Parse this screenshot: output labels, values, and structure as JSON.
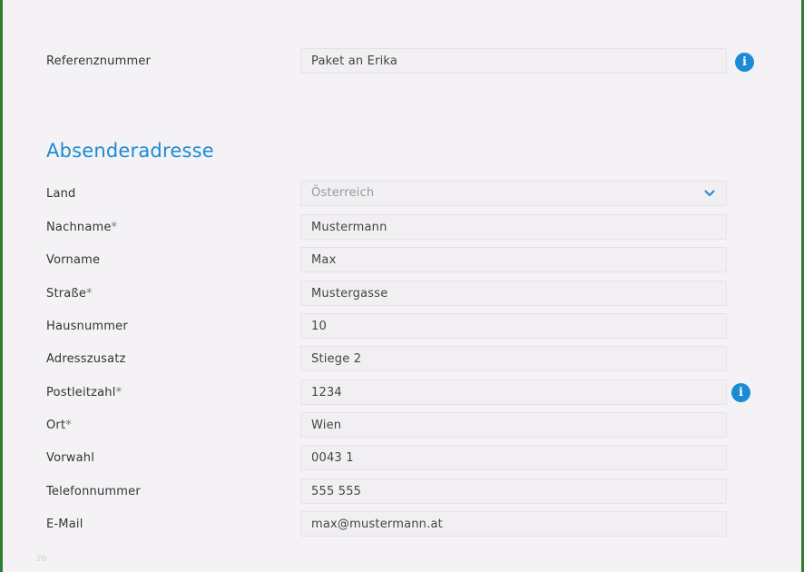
{
  "reference": {
    "label": "Referenznummer",
    "value": "Paket an Erika"
  },
  "section": {
    "title": "Absenderadresse"
  },
  "fields": {
    "land": {
      "label": "Land",
      "value": "Österreich"
    },
    "nachname": {
      "label": "Nachname",
      "value": "Mustermann",
      "required_mark": "*"
    },
    "vorname": {
      "label": "Vorname",
      "value": "Max"
    },
    "strasse": {
      "label": "Straße",
      "value": "Mustergasse",
      "required_mark": "*"
    },
    "hausnummer": {
      "label": "Hausnummer",
      "value": "10"
    },
    "adresszusatz": {
      "label": "Adresszusatz",
      "value": "Stiege 2"
    },
    "postleitzahl": {
      "label": "Postleitzahl",
      "value": "1234",
      "required_mark": "*"
    },
    "ort": {
      "label": "Ort",
      "value": "Wien",
      "required_mark": "*"
    },
    "vorwahl": {
      "label": "Vorwahl",
      "value": "0043 1"
    },
    "telefonnummer": {
      "label": "Telefonnummer",
      "value": "555 555"
    },
    "email": {
      "label": "E-Mail",
      "value": "max@mustermann.at"
    }
  },
  "info_icon": {
    "glyph": "i",
    "color": "#1b8bd3"
  },
  "footer": {
    "page_number": "20"
  },
  "colors": {
    "accent": "#1b8bd3",
    "background": "#f4f2f5",
    "frame": "#2e7d32"
  }
}
